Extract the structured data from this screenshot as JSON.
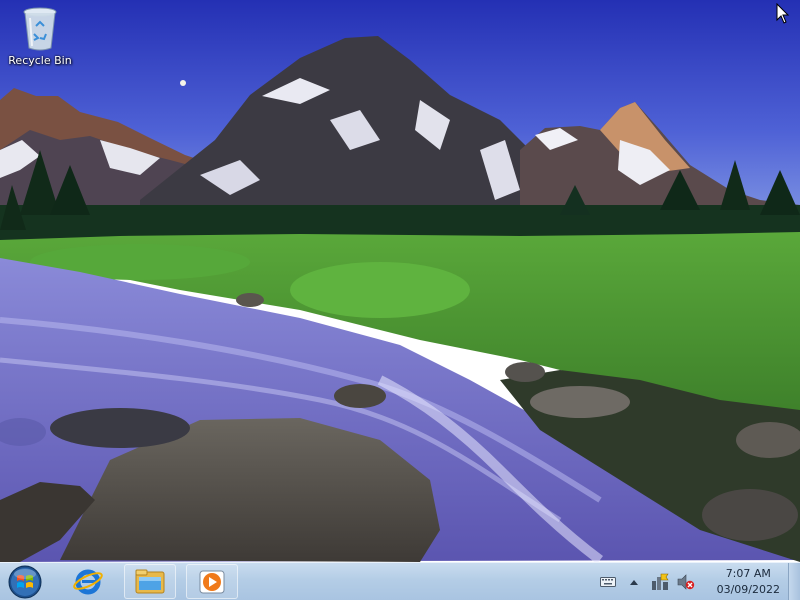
{
  "desktop": {
    "icons": [
      {
        "label": "Recycle Bin",
        "icon": "recycle-bin-icon"
      }
    ]
  },
  "taskbar": {
    "start_icon": "windows-start-icon",
    "pinned": [
      {
        "icon": "internet-explorer-icon"
      },
      {
        "icon": "file-explorer-icon"
      },
      {
        "icon": "media-player-icon"
      }
    ],
    "tray": {
      "icons": [
        "keyboard-icon",
        "show-hidden-icons-chevron",
        "action-center-flag-icon",
        "volume-muted-icon"
      ],
      "clock": {
        "time": "7:07 AM",
        "date": "03/09/2022"
      }
    }
  },
  "colors": {
    "taskbar": "#b4cde6",
    "sky_top": "#2733b8",
    "sky_bottom": "#6f86e0",
    "grass": "#4f9a35",
    "water": "#6f6bc6"
  }
}
